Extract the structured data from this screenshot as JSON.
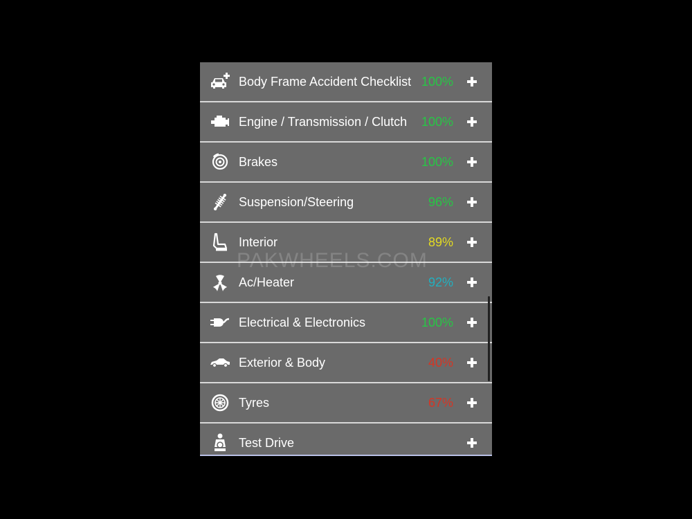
{
  "watermark": "PAKWHEELS.COM",
  "colors": {
    "green": "#27c645",
    "yellow": "#e3da22",
    "cyan": "#22b0bf",
    "red": "#d63524"
  },
  "items": [
    {
      "icon": "car-plus-icon",
      "label": "Body Frame Accident Checklist",
      "percent": "100%",
      "color": "#27c645"
    },
    {
      "icon": "engine-icon",
      "label": "Engine / Transmission / Clutch",
      "percent": "100%",
      "color": "#27c645"
    },
    {
      "icon": "brake-disc-icon",
      "label": "Brakes",
      "percent": "100%",
      "color": "#27c645"
    },
    {
      "icon": "shock-absorber-icon",
      "label": "Suspension/Steering",
      "percent": "96%",
      "color": "#27c645"
    },
    {
      "icon": "car-seat-icon",
      "label": "Interior",
      "percent": "89%",
      "color": "#e3da22"
    },
    {
      "icon": "fan-icon",
      "label": "Ac/Heater",
      "percent": "92%",
      "color": "#22b0bf"
    },
    {
      "icon": "plug-icon",
      "label": "Electrical & Electronics",
      "percent": "100%",
      "color": "#27c645"
    },
    {
      "icon": "car-side-icon",
      "label": "Exterior & Body",
      "percent": "40%",
      "color": "#d63524"
    },
    {
      "icon": "tyre-icon",
      "label": "Tyres",
      "percent": "67%",
      "color": "#d63524"
    },
    {
      "icon": "driver-icon",
      "label": "Test Drive",
      "percent": "",
      "color": "#27c645"
    }
  ]
}
